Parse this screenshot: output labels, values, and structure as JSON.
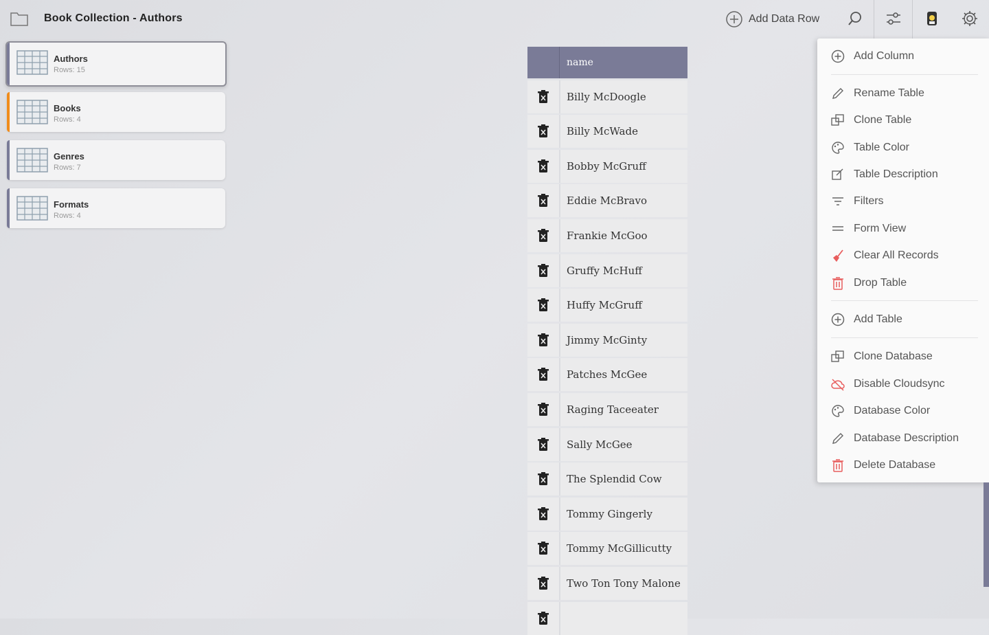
{
  "header": {
    "title": "Book Collection - Authors",
    "add_row_label": "Add Data Row"
  },
  "sidebar": {
    "tables": [
      {
        "name": "Authors",
        "rows": "Rows: 15",
        "accent": "#7a7b97"
      },
      {
        "name": "Books",
        "rows": "Rows: 4",
        "accent": "#f08c1c"
      },
      {
        "name": "Genres",
        "rows": "Rows: 7",
        "accent": "#7a7b97"
      },
      {
        "name": "Formats",
        "rows": "Rows: 4",
        "accent": "#7a7b97"
      }
    ]
  },
  "table": {
    "column": "name",
    "rows": [
      "Billy McDoogle",
      "Billy McWade",
      "Bobby McGruff",
      "Eddie McBravo",
      "Frankie McGoo",
      "Gruffy McHuff",
      "Huffy McGruff",
      "Jimmy McGinty",
      "Patches McGee",
      "Raging Taceeater",
      "Sally McGee",
      "The Splendid Cow",
      "Tommy Gingerly",
      "Tommy McGillicutty",
      "Two Ton Tony Malone",
      ""
    ]
  },
  "menu": {
    "items": [
      {
        "label": "Add Column",
        "icon": "plus-circle-icon"
      },
      {
        "label": "Rename Table",
        "icon": "pencil-icon"
      },
      {
        "label": "Clone Table",
        "icon": "clone-icon"
      },
      {
        "label": "Table Color",
        "icon": "palette-icon"
      },
      {
        "label": "Table Description",
        "icon": "edit-note-icon"
      },
      {
        "label": "Filters",
        "icon": "filter-icon"
      },
      {
        "label": "Form View",
        "icon": "form-icon"
      },
      {
        "label": "Clear All Records",
        "icon": "broom-icon"
      },
      {
        "label": "Drop Table",
        "icon": "trash-icon"
      },
      {
        "label": "Add Table",
        "icon": "plus-circle-icon"
      },
      {
        "label": "Clone Database",
        "icon": "clone-icon"
      },
      {
        "label": "Disable Cloudsync",
        "icon": "cloud-off-icon"
      },
      {
        "label": "Database Color",
        "icon": "palette-icon"
      },
      {
        "label": "Database Description",
        "icon": "pencil-icon"
      },
      {
        "label": "Delete Database",
        "icon": "trash-icon"
      }
    ]
  },
  "colors": {
    "accent": "#7a7b97",
    "danger": "#e85d5d",
    "books_accent": "#f08c1c"
  }
}
